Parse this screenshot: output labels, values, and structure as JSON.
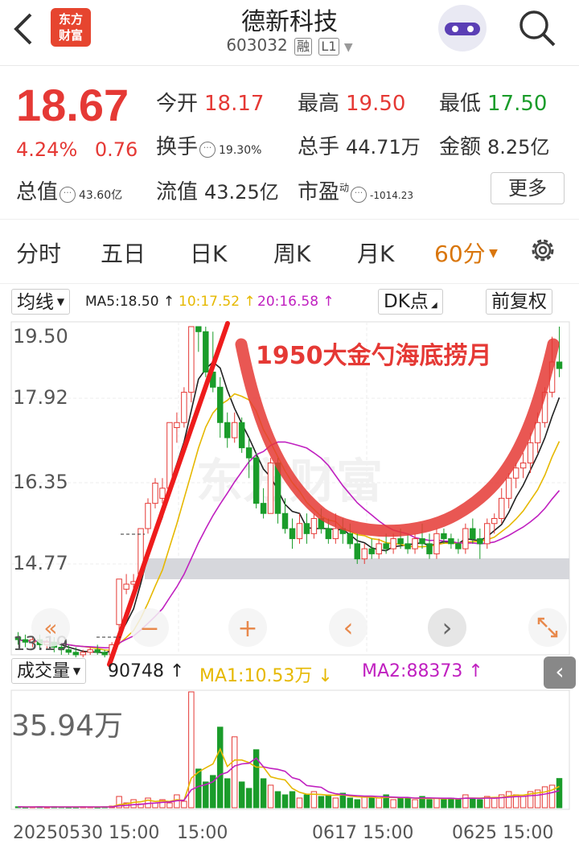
{
  "header": {
    "back_icon": "chevron-left-icon",
    "logo_line1": "东方",
    "logo_line2": "财富",
    "stock_name": "德新科技",
    "stock_code": "603032",
    "tag_margin": "融",
    "tag_level": "L1",
    "avatar_icon": "robot-avatar-icon",
    "search_icon": "search-icon"
  },
  "quote": {
    "price": "18.67",
    "change_pct": "4.24%",
    "change_amt": "0.76",
    "open_label": "今开",
    "open_value": "18.17",
    "high_label": "最高",
    "high_value": "19.50",
    "low_label": "最低",
    "low_value": "17.50",
    "turnover_label": "换手",
    "turnover_value": "19.30%",
    "volume_label": "总手",
    "volume_value": "44.71万",
    "amount_label": "金额",
    "amount_value": "8.25亿",
    "mktcap_label": "总值",
    "mktcap_value": "43.60亿",
    "float_label": "流值",
    "float_value": "43.25亿",
    "pe_label": "市盈",
    "pe_sup": "动",
    "pe_value": "-1014.23",
    "more_button": "更多",
    "colors": {
      "up": "#e53935",
      "down": "#1a9c2a"
    }
  },
  "tabs": {
    "items": [
      "分时",
      "五日",
      "日K",
      "周K",
      "月K",
      "60分"
    ],
    "active": "60分",
    "settings_icon": "gear-icon"
  },
  "indicator_bar": {
    "ma_dropdown": "均线",
    "ma5": "MA5:18.50 ↑",
    "ma10": "10:17.52 ↑",
    "ma20": "20:16.58 ↑",
    "dk_dropdown": "DK点",
    "adjust_button": "前复权"
  },
  "price_axis": {
    "labels": [
      "19.50",
      "17.92",
      "16.35",
      "14.77",
      "13.19"
    ]
  },
  "annotation": {
    "text": "1950大金勺海底捞月",
    "color": "#e53935"
  },
  "watermark": "东方财富",
  "controls": {
    "icons": [
      "double-left-arrow-icon",
      "zoom-out-icon",
      "zoom-in-icon",
      "chevron-left-icon",
      "chevron-right-icon",
      "expand-icon"
    ],
    "minus": "−",
    "plus": "+",
    "left": "‹",
    "right": "›"
  },
  "volume": {
    "dropdown": "成交量",
    "current": "90748 ↑",
    "ma1": "MA1:10.53万 ↓",
    "ma2": "MA2:88373 ↑",
    "max_label": "35.94万",
    "collapse_icon": "chevron-left-icon",
    "colors": {
      "ma1": "#e6b800",
      "ma2": "#c020c0"
    }
  },
  "time_axis": {
    "labels": [
      "20250530 15:00",
      "15:00",
      "0617 15:00",
      "0625 15:00"
    ]
  },
  "chart_data": {
    "type": "candlestick",
    "y_range": [
      13.19,
      19.5
    ],
    "ma_colors": {
      "ma5": "#222222",
      "ma10": "#e6b800",
      "ma20": "#c020c0"
    },
    "candles": [
      [
        13.35,
        13.3,
        13.45,
        13.2
      ],
      [
        13.3,
        13.25,
        13.4,
        13.15
      ],
      [
        13.25,
        13.3,
        13.35,
        13.15
      ],
      [
        13.3,
        13.2,
        13.4,
        13.1
      ],
      [
        13.2,
        13.25,
        13.3,
        13.1
      ],
      [
        13.25,
        13.15,
        13.35,
        13.05
      ],
      [
        13.15,
        13.1,
        13.25,
        13.0
      ],
      [
        13.1,
        13.05,
        13.2,
        13.0
      ],
      [
        13.05,
        13.0,
        13.15,
        12.95
      ],
      [
        13.0,
        13.05,
        13.1,
        12.95
      ],
      [
        13.05,
        13.1,
        13.15,
        13.0
      ],
      [
        13.1,
        13.05,
        13.2,
        13.0
      ],
      [
        13.05,
        13.0,
        13.1,
        12.95
      ],
      [
        13.0,
        13.2,
        13.25,
        12.95
      ],
      [
        13.6,
        14.5,
        14.5,
        13.2
      ],
      [
        14.3,
        14.4,
        14.6,
        14.2
      ],
      [
        14.4,
        14.45,
        14.6,
        14.3
      ],
      [
        14.6,
        15.5,
        15.5,
        14.5
      ],
      [
        15.5,
        16.0,
        16.1,
        15.4
      ],
      [
        16.0,
        16.4,
        16.5,
        15.9
      ],
      [
        16.1,
        16.3,
        16.5,
        16.0
      ],
      [
        16.3,
        17.6,
        17.6,
        16.2
      ],
      [
        17.5,
        17.6,
        17.8,
        17.2
      ],
      [
        17.6,
        18.2,
        18.3,
        17.5
      ],
      [
        18.2,
        19.5,
        19.5,
        18.0
      ],
      [
        19.5,
        19.4,
        19.5,
        19.0
      ],
      [
        19.4,
        18.6,
        19.5,
        18.5
      ],
      [
        18.6,
        18.3,
        19.4,
        18.2
      ],
      [
        18.3,
        17.6,
        18.5,
        17.3
      ],
      [
        17.6,
        17.3,
        17.8,
        17.1
      ],
      [
        17.3,
        17.6,
        17.8,
        17.2
      ],
      [
        17.6,
        17.1,
        17.7,
        17.0
      ],
      [
        17.1,
        16.9,
        17.3,
        16.5
      ],
      [
        16.9,
        16.0,
        17.0,
        15.9
      ],
      [
        16.0,
        15.8,
        16.3,
        15.7
      ],
      [
        15.8,
        16.8,
        16.9,
        15.8
      ],
      [
        16.8,
        15.8,
        16.9,
        15.6
      ],
      [
        15.8,
        15.5,
        16.1,
        15.4
      ],
      [
        15.5,
        15.3,
        15.7,
        15.1
      ],
      [
        15.3,
        15.6,
        15.8,
        15.2
      ],
      [
        15.6,
        15.4,
        15.8,
        15.2
      ],
      [
        15.4,
        15.7,
        15.8,
        15.3
      ],
      [
        15.7,
        15.5,
        15.9,
        15.4
      ],
      [
        15.5,
        15.3,
        15.7,
        15.2
      ],
      [
        15.3,
        15.5,
        15.8,
        15.2
      ],
      [
        15.5,
        15.4,
        15.7,
        15.2
      ],
      [
        15.4,
        15.2,
        15.6,
        15.1
      ],
      [
        15.2,
        14.9,
        15.4,
        14.8
      ],
      [
        14.9,
        15.1,
        15.2,
        14.8
      ],
      [
        15.1,
        15.0,
        15.3,
        14.9
      ],
      [
        15.0,
        15.2,
        15.3,
        14.9
      ],
      [
        15.2,
        15.1,
        15.4,
        15.0
      ],
      [
        15.1,
        15.3,
        15.4,
        15.0
      ],
      [
        15.3,
        15.2,
        15.5,
        15.1
      ],
      [
        15.2,
        15.1,
        15.4,
        15.0
      ],
      [
        15.1,
        15.3,
        15.4,
        15.0
      ],
      [
        15.3,
        15.2,
        15.6,
        15.1
      ],
      [
        15.2,
        15.0,
        15.4,
        14.9
      ],
      [
        15.0,
        15.4,
        15.5,
        14.9
      ],
      [
        15.4,
        15.3,
        15.5,
        15.2
      ],
      [
        15.3,
        15.2,
        15.4,
        15.1
      ],
      [
        15.2,
        15.1,
        15.3,
        15.0
      ],
      [
        15.1,
        15.5,
        15.6,
        15.0
      ],
      [
        15.5,
        15.3,
        15.7,
        15.2
      ],
      [
        15.3,
        15.2,
        15.5,
        14.9
      ],
      [
        15.2,
        15.6,
        15.7,
        15.1
      ],
      [
        15.6,
        15.7,
        15.8,
        15.4
      ],
      [
        15.7,
        16.1,
        16.3,
        15.6
      ],
      [
        16.1,
        16.5,
        16.6,
        15.9
      ],
      [
        16.5,
        16.7,
        16.8,
        16.3
      ],
      [
        16.7,
        16.8,
        17.0,
        16.5
      ],
      [
        16.8,
        17.2,
        17.4,
        16.6
      ],
      [
        17.2,
        17.6,
        17.8,
        17.0
      ],
      [
        17.6,
        18.2,
        18.3,
        17.5
      ],
      [
        18.2,
        18.8,
        19.3,
        18.1
      ],
      [
        18.8,
        18.67,
        19.5,
        18.5
      ]
    ],
    "volumes": [
      0.3,
      0.2,
      0.25,
      0.3,
      0.2,
      0.3,
      0.25,
      0.2,
      0.2,
      0.3,
      0.25,
      0.2,
      0.3,
      0.5,
      3.5,
      1.5,
      2.5,
      1.2,
      3.0,
      1.5,
      2.5,
      1.5,
      4.0,
      2.0,
      35.94,
      12.0,
      8.0,
      10.0,
      25.0,
      9.0,
      22.0,
      8.0,
      6.0,
      18.0,
      9.0,
      7.0,
      5.0,
      4.0,
      5.0,
      3.0,
      4.0,
      5.0,
      3.5,
      4.0,
      3.0,
      4.5,
      3.0,
      2.5,
      3.5,
      3.0,
      3.0,
      4.0,
      2.5,
      3.0,
      3.0,
      2.5,
      3.5,
      2.5,
      3.0,
      2.5,
      3.0,
      2.5,
      4.0,
      3.0,
      2.5,
      3.5,
      3.0,
      4.0,
      5.0,
      4.0,
      3.5,
      5.0,
      5.5,
      6.5,
      7.0,
      9.07
    ]
  }
}
